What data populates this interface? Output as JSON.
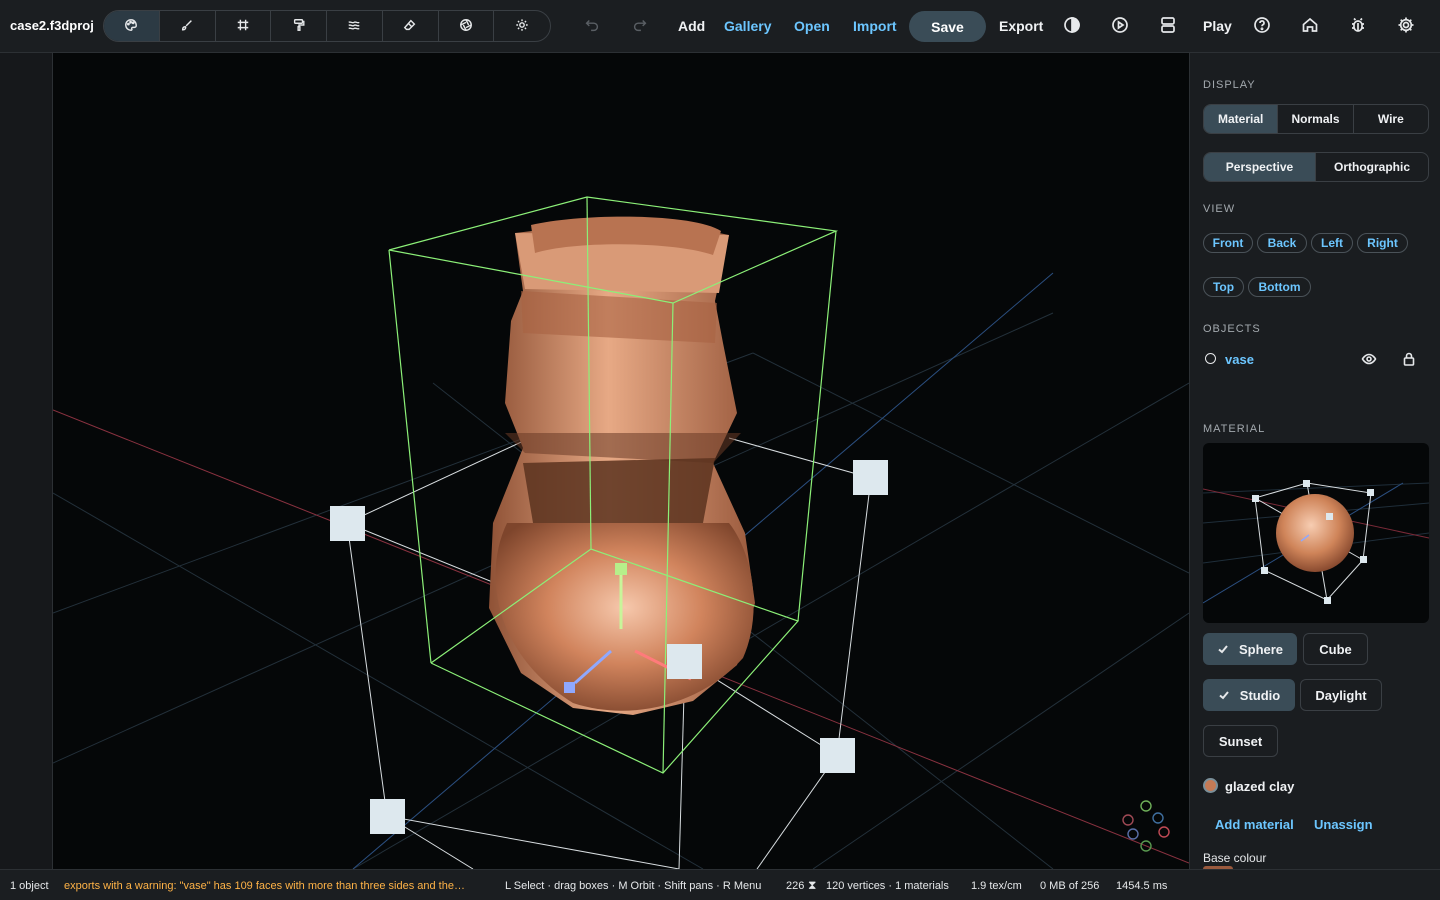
{
  "project": {
    "name": "case2.f3dproj"
  },
  "toolbar": {
    "tools": [
      {
        "name": "palette-icon",
        "active": true
      },
      {
        "name": "brush-icon",
        "active": false
      },
      {
        "name": "grid-icon",
        "active": false
      },
      {
        "name": "paint-roller-icon",
        "active": false
      },
      {
        "name": "waves-icon",
        "active": false
      },
      {
        "name": "eraser-icon",
        "active": false
      },
      {
        "name": "aperture-icon",
        "active": false
      },
      {
        "name": "sun-icon",
        "active": false
      }
    ],
    "undo_icon": "undo-icon",
    "redo_icon": "redo-icon",
    "add_label": "Add",
    "gallery_label": "Gallery",
    "open_label": "Open",
    "import_label": "Import",
    "save_label": "Save",
    "export_label": "Export",
    "play_label": "Play",
    "icons": [
      "contrast-icon",
      "play-circle-icon",
      "layout-icon",
      "help-icon",
      "home-icon",
      "bug-icon",
      "gear-icon"
    ]
  },
  "panel": {
    "display_title": "DISPLAY",
    "display_modes": [
      "Material",
      "Normals",
      "Wire"
    ],
    "display_active": "Material",
    "projections": [
      "Perspective",
      "Orthographic"
    ],
    "projection_active": "Perspective",
    "view_title": "VIEW",
    "views_row1": [
      "Front",
      "Back",
      "Left",
      "Right"
    ],
    "views_row2": [
      "Top",
      "Bottom"
    ],
    "objects_title": "OBJECTS",
    "objects": [
      {
        "name": "vase"
      }
    ],
    "material_title": "MATERIAL",
    "preview_shapes": [
      "Sphere",
      "Cube"
    ],
    "preview_shape_active": "Sphere",
    "lighting": [
      "Studio",
      "Daylight",
      "Sunset"
    ],
    "lighting_active": "Studio",
    "material_name": "glazed clay",
    "material_color": "#c47a55",
    "add_material_label": "Add material",
    "unassign_label": "Unassign",
    "base_colour_label": "Base colour"
  },
  "status": {
    "objects": "1 object",
    "warning": "exports with a warning: \"vase\" has 109 faces with more than three sides and the…",
    "hints": "L Select · drag boxes · M Orbit · Shift pans · R Menu",
    "polycount": "226",
    "counts": "120 vertices · 1 materials",
    "texel": "1.9 tex/cm",
    "memory": "0 MB of 256",
    "frame_time": "1454.5 ms"
  },
  "colors": {
    "accent": "#6cc6ff",
    "active_button": "#3a4c57",
    "warning": "#ffb347",
    "selection_box": "#8cf078",
    "clay": "#c47a55"
  }
}
